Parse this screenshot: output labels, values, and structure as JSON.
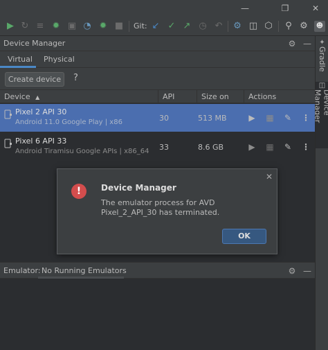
{
  "toolbar": {
    "git_label": "Git:"
  },
  "right_stripe": {
    "gradle_label": "Gradle",
    "device_manager_label": "Device Manager"
  },
  "device_manager": {
    "title": "Device Manager",
    "tabs": [
      {
        "label": "Virtual",
        "active": true
      },
      {
        "label": "Physical",
        "active": false
      }
    ],
    "create_device_label": "Create device",
    "help_label": "?",
    "columns": {
      "device": "Device",
      "api": "API",
      "size": "Size on Disk",
      "actions": "Actions"
    },
    "devices": [
      {
        "name": "Pixel 2 API 30",
        "subtitle": "Android 11.0 Google Play | x86",
        "api": "30",
        "size": "513 MB",
        "selected": true
      },
      {
        "name": "Pixel 6 API 33",
        "subtitle": "Android Tiramisu Google APIs | x86_64",
        "api": "33",
        "size": "8.6 GB",
        "selected": false
      }
    ]
  },
  "dialog": {
    "title": "Device Manager",
    "message": "The emulator process for AVD Pixel_2_API_30 has terminated.",
    "ok_label": "OK"
  },
  "emulator": {
    "label": "Emulator:",
    "tab_label": "No Running Emulators"
  },
  "colors": {
    "background": "#2b2d30",
    "panel": "#3c3f41",
    "selection": "#4b6eaf",
    "accent": "#4a88c7",
    "error": "#d34d4d",
    "run_green": "#59a869"
  }
}
